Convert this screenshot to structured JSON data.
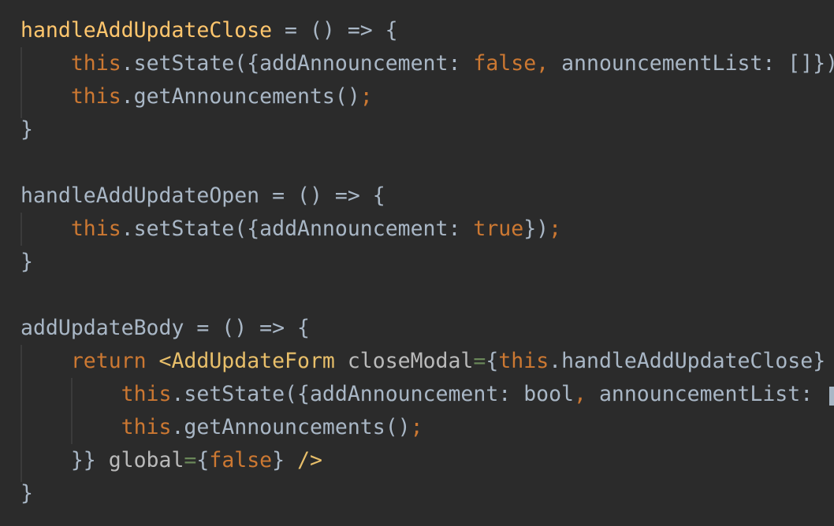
{
  "editor": {
    "theme_colors": {
      "background": "#2b2b2b",
      "default_text": "#a9b7c6",
      "keyword": "#cc7832",
      "function_declaration": "#ffc66d",
      "jsx_tag": "#e8bf6a",
      "jsx_attribute": "#bababa",
      "jsx_equals": "#6a8759",
      "indent_guide": "#3b3b3b"
    },
    "lines": [
      [
        [
          "fn",
          "handleAddUpdateClose"
        ],
        [
          "plain",
          " = () => {"
        ]
      ],
      [
        [
          "plain",
          "    "
        ],
        [
          "kw",
          "this"
        ],
        [
          "plain",
          ".setState({addAnnouncement: "
        ],
        [
          "kw",
          "false"
        ],
        [
          "punc",
          ","
        ],
        [
          "plain",
          " announcementList: []})"
        ]
      ],
      [
        [
          "plain",
          "    "
        ],
        [
          "kw",
          "this"
        ],
        [
          "plain",
          ".getAnnouncements()"
        ],
        [
          "punc",
          ";"
        ]
      ],
      [
        [
          "plain",
          "}"
        ]
      ],
      [
        [
          "plain",
          ""
        ]
      ],
      [
        [
          "plain",
          "handleAddUpdateOpen = () => {"
        ]
      ],
      [
        [
          "plain",
          "    "
        ],
        [
          "kw",
          "this"
        ],
        [
          "plain",
          ".setState({addAnnouncement: "
        ],
        [
          "kw",
          "true"
        ],
        [
          "plain",
          "})"
        ],
        [
          "punc",
          ";"
        ]
      ],
      [
        [
          "plain",
          "}"
        ]
      ],
      [
        [
          "plain",
          ""
        ]
      ],
      [
        [
          "plain",
          "addUpdateBody = () => {"
        ]
      ],
      [
        [
          "plain",
          "    "
        ],
        [
          "kw",
          "return "
        ],
        [
          "tag",
          "<AddUpdateForm "
        ],
        [
          "attr",
          "closeModal"
        ],
        [
          "eq",
          "="
        ],
        [
          "plain",
          "{"
        ],
        [
          "kw",
          "this"
        ],
        [
          "plain",
          ".handleAddUpdateClose}"
        ]
      ],
      [
        [
          "plain",
          "        "
        ],
        [
          "kw",
          "this"
        ],
        [
          "plain",
          ".setState({addAnnouncement: bool"
        ],
        [
          "punc",
          ","
        ],
        [
          "plain",
          " announcementList: "
        ]
      ],
      [
        [
          "plain",
          "        "
        ],
        [
          "kw",
          "this"
        ],
        [
          "plain",
          ".getAnnouncements()"
        ],
        [
          "punc",
          ";"
        ]
      ],
      [
        [
          "plain",
          "    }} "
        ],
        [
          "attr",
          "global"
        ],
        [
          "eq",
          "="
        ],
        [
          "plain",
          "{"
        ],
        [
          "kw",
          "false"
        ],
        [
          "plain",
          "} "
        ],
        [
          "tag",
          "/>"
        ]
      ],
      [
        [
          "plain",
          "}"
        ]
      ]
    ]
  }
}
